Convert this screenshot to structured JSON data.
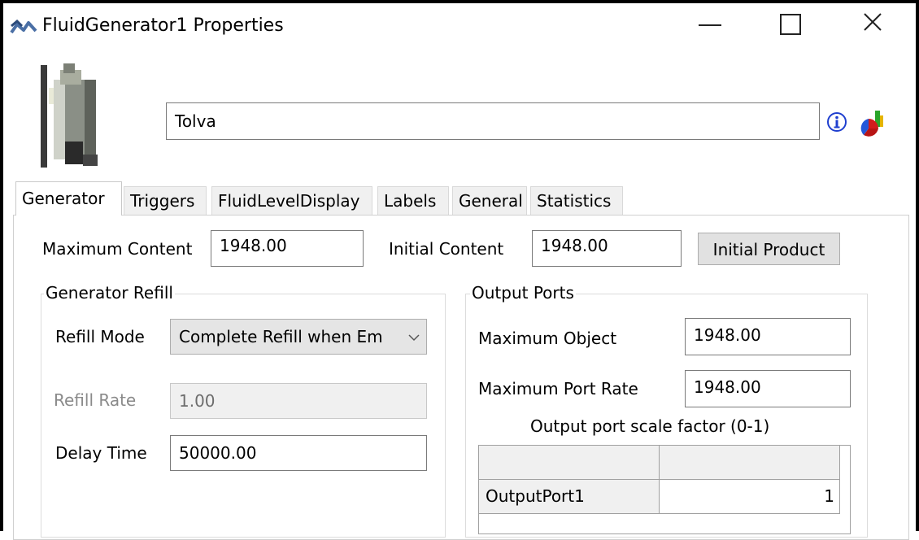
{
  "window": {
    "title": "FluidGenerator1  Properties",
    "controls": {
      "minimize": "—",
      "maximize": "☐",
      "close": "✕"
    }
  },
  "header": {
    "object_name": "Tolva",
    "icons": [
      "app-logo-icon",
      "fluid-generator-object-icon",
      "info-icon",
      "statistics-chart-icon"
    ]
  },
  "tabs": [
    {
      "label": "Generator",
      "active": true
    },
    {
      "label": "Triggers"
    },
    {
      "label": "FluidLevelDisplay"
    },
    {
      "label": "Labels"
    },
    {
      "label": "General"
    },
    {
      "label": "Statistics"
    }
  ],
  "generator": {
    "maximum_content_label": "Maximum Content",
    "maximum_content_value": "1948.00",
    "initial_content_label": "Initial Content",
    "initial_content_value": "1948.00",
    "initial_product_button": "Initial Product"
  },
  "refill": {
    "group_title": "Generator Refill",
    "mode_label": "Refill Mode",
    "mode_value": "Complete Refill when Em",
    "rate_label": "Refill Rate",
    "rate_value": "1.00",
    "delay_label": "Delay Time",
    "delay_value": "50000.00"
  },
  "output_ports": {
    "group_title": "Output Ports",
    "max_object_label": "Maximum Object",
    "max_object_value": "1948.00",
    "max_port_rate_label": "Maximum Port Rate",
    "max_port_rate_value": "1948.00",
    "scale_factor_label": "Output port scale factor (0-1)",
    "table": {
      "headers": [
        "",
        ""
      ],
      "rows": [
        {
          "name": "OutputPort1",
          "value": "1"
        }
      ]
    }
  },
  "colors": {
    "border": "#000000",
    "info_icon": "#1f3fcf",
    "chart_red": "#d11c1c",
    "chart_green": "#2aa52a",
    "chart_yellow": "#e4b500",
    "chart_blue": "#2357d9"
  }
}
